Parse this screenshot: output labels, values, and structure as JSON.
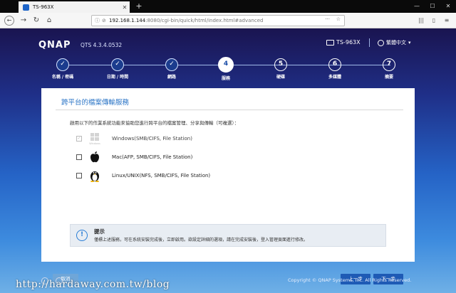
{
  "browser": {
    "tab_title": "TS-963X",
    "url_host": "192.168.1.144",
    "url_path": ":8080/cgi-bin/quick/html/index.html#advanced"
  },
  "header": {
    "logo": "QNAP",
    "version": "QTS 4.3.4.0532",
    "device_name": "TS-963X",
    "language": "繁體中文"
  },
  "steps": [
    {
      "num": "✓",
      "label": "名稱 / 密碼",
      "state": "done"
    },
    {
      "num": "✓",
      "label": "日期 / 時間",
      "state": "done"
    },
    {
      "num": "✓",
      "label": "網路",
      "state": "done"
    },
    {
      "num": "4",
      "label": "服務",
      "state": "active"
    },
    {
      "num": "5",
      "label": "硬碟",
      "state": "todo"
    },
    {
      "num": "6",
      "label": "多媒體",
      "state": "todo"
    },
    {
      "num": "7",
      "label": "摘要",
      "state": "todo"
    }
  ],
  "panel": {
    "title": "跨平台的檔案傳輸服務",
    "intro": "啟用以下的作業系統功能來協助您進行跨平台的檔案管理、分享與傳輸（可複選）：",
    "options": [
      {
        "label": "Windows(SMB/CIFS, File Station)",
        "icon": "windows-icon",
        "icon_caption": "Windows",
        "checked": true,
        "disabled": true
      },
      {
        "label": "Mac(AFP, SMB/CIFS, File Station)",
        "icon": "apple-icon",
        "checked": false,
        "disabled": false
      },
      {
        "label": "Linux/UNIX(NFS, SMB/CIFS, File Station)",
        "icon": "linux-icon",
        "checked": false,
        "disabled": false
      }
    ],
    "tip": {
      "title": "提示",
      "text": "僅標上述服務，可在系統安裝完成後，立即啟用。欲設定詳細的選項，請在完成安裝後，登入管理頁面進行修改。"
    }
  },
  "buttons": {
    "cancel": "取消",
    "back": "上一步",
    "next": "下一步"
  },
  "footer": {
    "copyright": "Copyright © QNAP Systems, Inc. All Rights Reserved.",
    "watermark": "http://hardaway.com.tw/blog"
  },
  "colors": {
    "accent": "#2a74c6",
    "primary_button": "#1e5ab5",
    "secondary_button": "#6fa6d8"
  }
}
